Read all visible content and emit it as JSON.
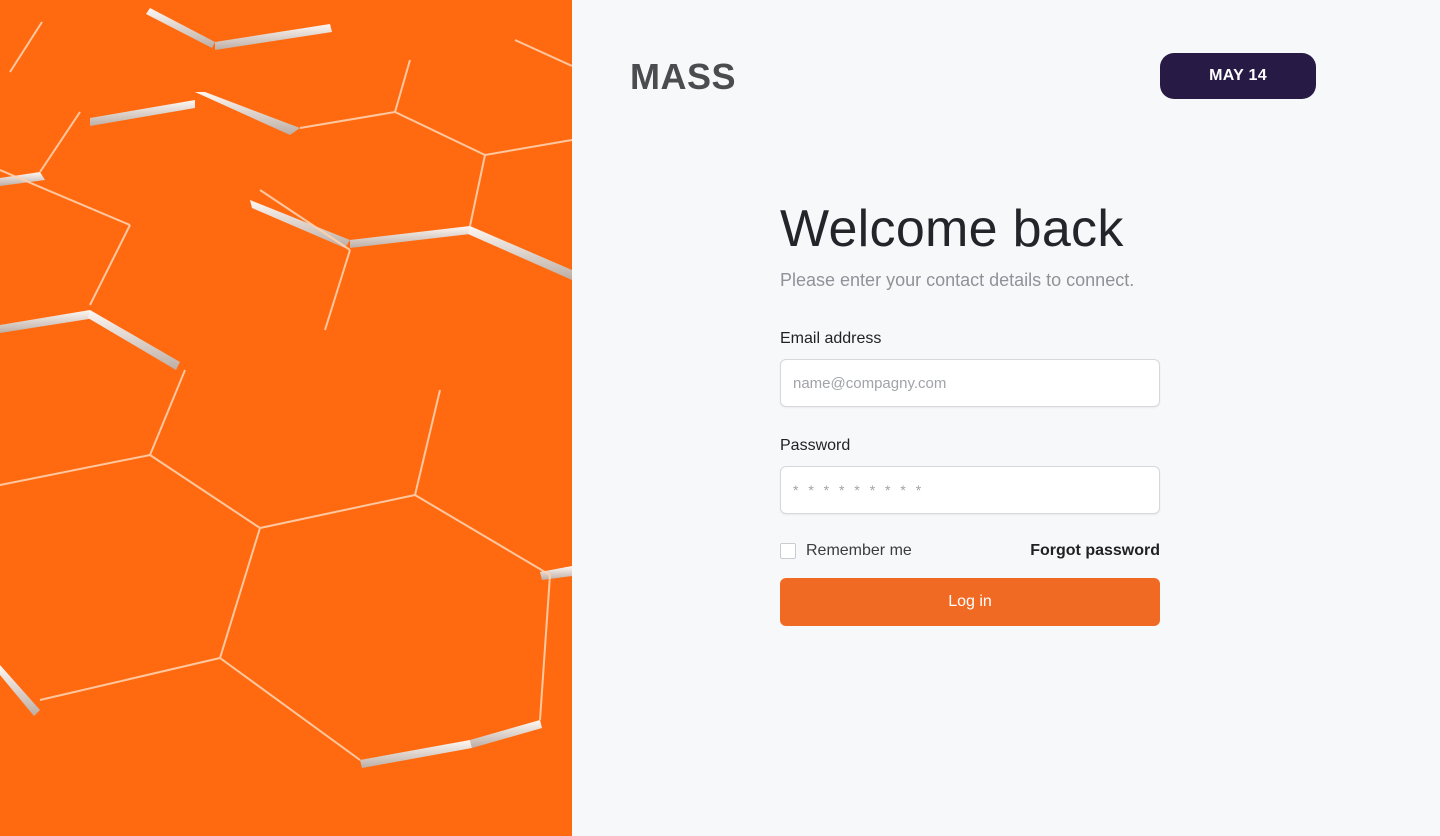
{
  "brand": {
    "name": "MASS"
  },
  "header": {
    "date_badge": "MAY 14"
  },
  "form": {
    "title": "Welcome back",
    "subtitle": "Please enter your contact details to connect.",
    "email": {
      "label": "Email address",
      "placeholder": "name@compagny.com",
      "value": ""
    },
    "password": {
      "label": "Password",
      "placeholder": "* * * * * * * * *",
      "value": ""
    },
    "remember_label": "Remember me",
    "remember_checked": false,
    "forgot_label": "Forgot password",
    "login_label": "Log in"
  },
  "colors": {
    "hero_orange": "#ff6a10",
    "button_orange": "#f06a24",
    "badge_purple": "#271a45",
    "background": "#f7f8fa"
  }
}
